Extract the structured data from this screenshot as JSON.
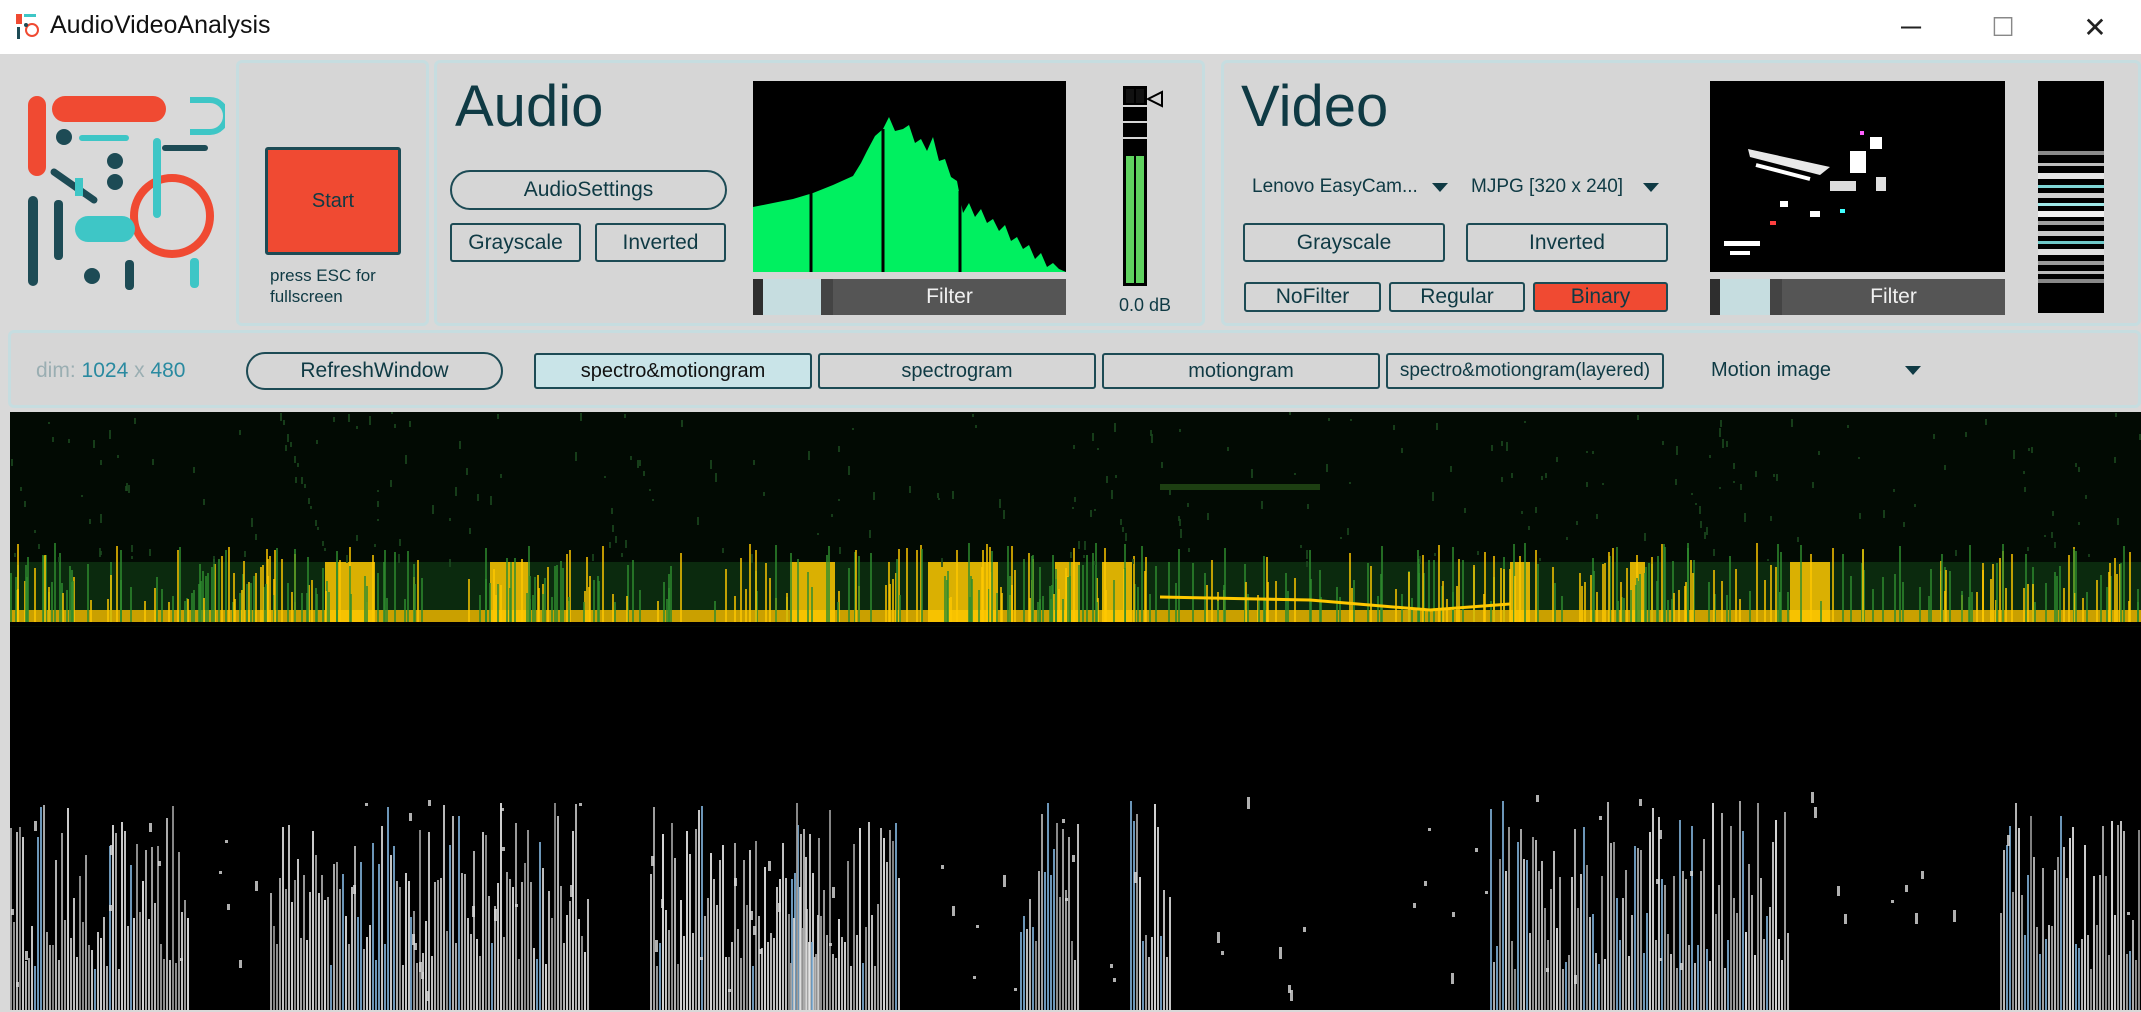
{
  "window": {
    "title": "AudioVideoAnalysis",
    "minimize_glyph": "─",
    "maximize_glyph": "☐",
    "close_glyph": "✕"
  },
  "start_panel": {
    "start_label": "Start",
    "esc_hint": "press ESC for fullscreen"
  },
  "audio": {
    "heading": "Audio",
    "settings_label": "AudioSettings",
    "grayscale_label": "Grayscale",
    "inverted_label": "Inverted",
    "filter_label": "Filter",
    "level_readout": "0.0 dB",
    "colors": {
      "spectrum": "#00f060",
      "meter": "#5fd35f"
    }
  },
  "video": {
    "heading": "Video",
    "device_selected": "Lenovo EasyCam...",
    "format_selected": "MJPG [320 x 240]",
    "grayscale_label": "Grayscale",
    "inverted_label": "Inverted",
    "nofilter_label": "NoFilter",
    "regular_label": "Regular",
    "binary_label": "Binary",
    "filter_label": "Filter"
  },
  "toolbar": {
    "dim_label": "dim:",
    "dim_width": "1024",
    "dim_x": "x",
    "dim_height": "480",
    "refresh_label": "RefreshWindow",
    "modes": [
      "spectro&motiongram",
      "spectrogram",
      "motiongram",
      "spectro&motiongram(layered)"
    ],
    "active_mode": "spectro&motiongram",
    "image_select": "Motion image"
  },
  "colors": {
    "accent_red": "#f04a32",
    "dark_teal": "#0f3a44",
    "light_teal": "#c6dde0",
    "spectro_yellow": "#ffc800",
    "spectro_green": "#1f6b22"
  }
}
